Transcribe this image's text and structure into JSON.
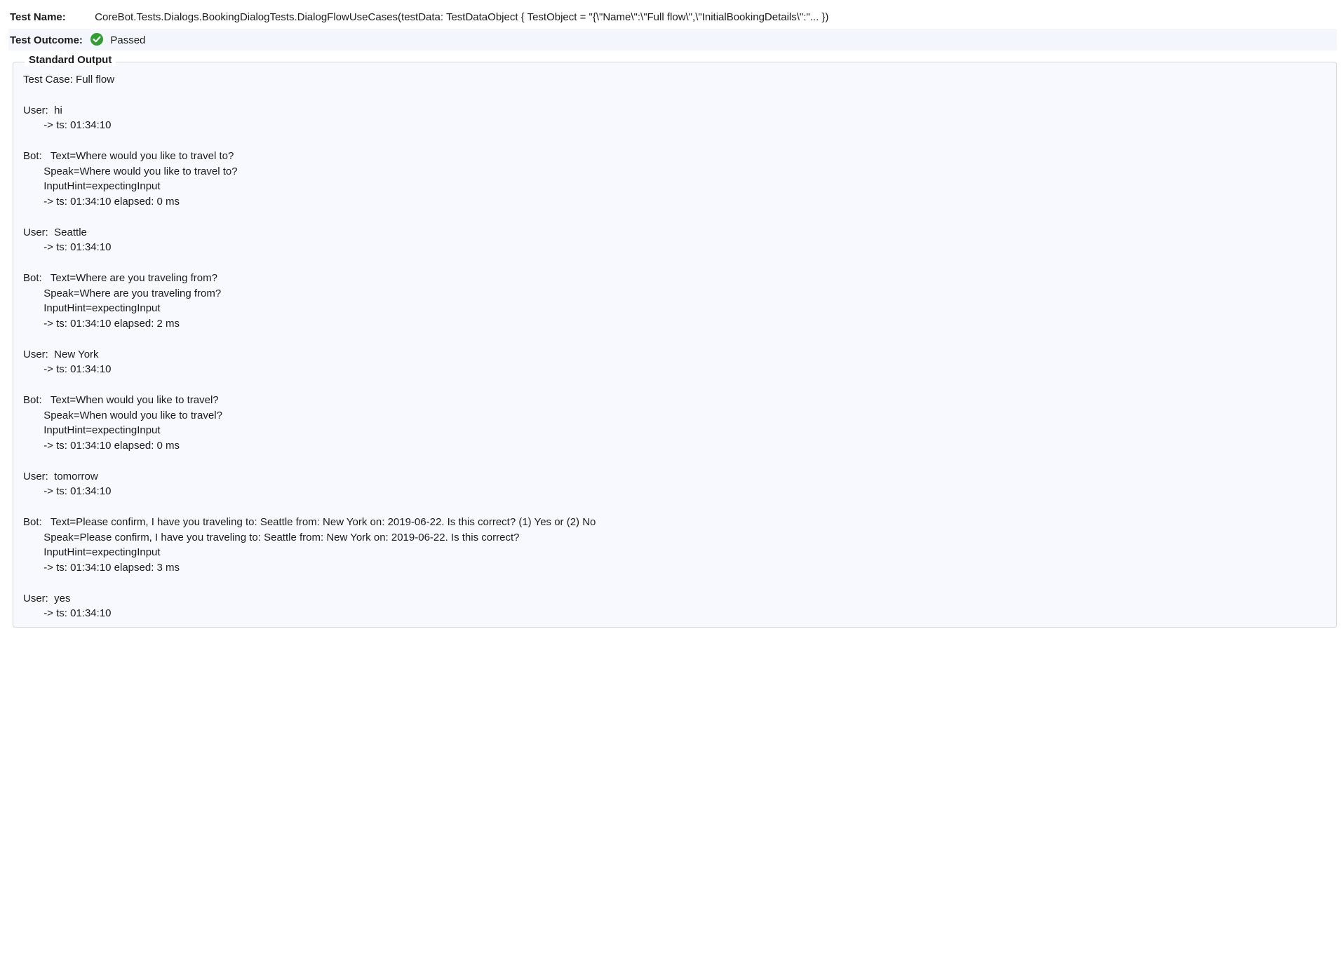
{
  "meta": {
    "name_label": "Test Name:",
    "name_value": "CoreBot.Tests.Dialogs.BookingDialogTests.DialogFlowUseCases(testData: TestDataObject { TestObject = \"{\\\"Name\\\":\\\"Full flow\\\",\\\"InitialBookingDetails\\\":\"... })",
    "outcome_label": "Test Outcome:",
    "outcome_value": "Passed"
  },
  "output": {
    "heading": "Standard Output",
    "text": "Test Case: Full flow\n\nUser:  hi\n       -> ts: 01:34:10\n\nBot:   Text=Where would you like to travel to?\n       Speak=Where would you like to travel to?\n       InputHint=expectingInput\n       -> ts: 01:34:10 elapsed: 0 ms\n\nUser:  Seattle\n       -> ts: 01:34:10\n\nBot:   Text=Where are you traveling from?\n       Speak=Where are you traveling from?\n       InputHint=expectingInput\n       -> ts: 01:34:10 elapsed: 2 ms\n\nUser:  New York\n       -> ts: 01:34:10\n\nBot:   Text=When would you like to travel?\n       Speak=When would you like to travel?\n       InputHint=expectingInput\n       -> ts: 01:34:10 elapsed: 0 ms\n\nUser:  tomorrow\n       -> ts: 01:34:10\n\nBot:   Text=Please confirm, I have you traveling to: Seattle from: New York on: 2019-06-22. Is this correct? (1) Yes or (2) No\n       Speak=Please confirm, I have you traveling to: Seattle from: New York on: 2019-06-22. Is this correct?\n       InputHint=expectingInput\n       -> ts: 01:34:10 elapsed: 3 ms\n\nUser:  yes\n       -> ts: 01:34:10"
  }
}
